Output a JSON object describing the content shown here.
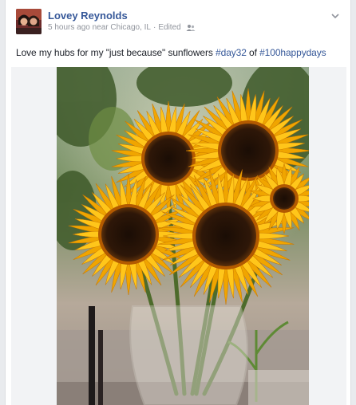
{
  "post": {
    "author_name": "Lovey Reynolds",
    "time": "5 hours ago",
    "location_prefix": "near",
    "location": "Chicago, IL",
    "separator": "·",
    "edited_label": "Edited",
    "audience_icon": "friends-icon",
    "options_icon": "chevron-down-icon",
    "message": {
      "text_before": "Love my hubs for my \"just because\" sunflowers ",
      "hashtag_1": "#day32",
      "text_middle": " of ",
      "hashtag_2": "#100happydays"
    },
    "photo_subject": "sunflowers-in-vase"
  },
  "colors": {
    "link": "#365899",
    "meta": "#90949c",
    "text": "#1d2129",
    "background": "#e9ebee",
    "petal": "#f2b705",
    "flower_center": "#3a1f0a"
  }
}
